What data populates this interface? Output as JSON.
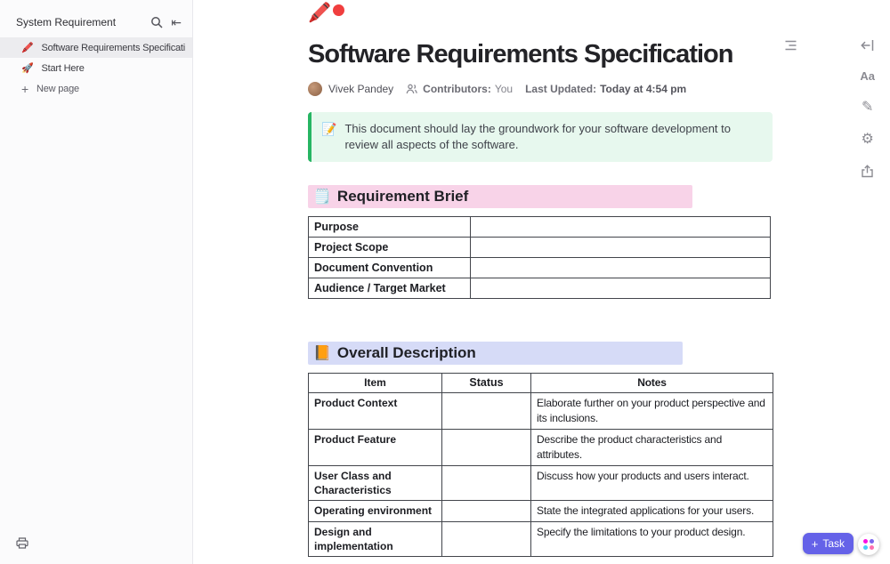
{
  "sidebar": {
    "title": "System Requirement",
    "collapse_icon": "⇤",
    "items": [
      {
        "icon": "🖍️",
        "label": "Software Requirements Specification",
        "selected": true
      },
      {
        "icon": "🚀",
        "label": "Start Here",
        "selected": false
      }
    ],
    "new_page": {
      "icon": "+",
      "label": "New page"
    }
  },
  "doc": {
    "page_icon": "🖍️",
    "title": "Software Requirements Specification",
    "meta": {
      "author": "Vivek Pandey",
      "contributors_label": "Contributors:",
      "contributors_value": "You",
      "updated_label": "Last Updated:",
      "updated_value": "Today at 4:54 pm"
    },
    "callout": {
      "icon": "📝",
      "text": "This document should lay the groundwork for your software development to review all aspects of the software."
    },
    "section_brief": {
      "icon": "🗒️",
      "title": "Requirement Brief"
    },
    "brief_rows": [
      {
        "label": "Purpose",
        "value": ""
      },
      {
        "label": "Project Scope",
        "value": ""
      },
      {
        "label": "Document Convention",
        "value": ""
      },
      {
        "label": "Audience / Target Market",
        "value": ""
      }
    ],
    "section_overall": {
      "icon": "📙",
      "title": "Overall Description"
    },
    "overall_table": {
      "headers": [
        "Item",
        "Status",
        "Notes"
      ],
      "rows": [
        {
          "item": "Product Context",
          "status": "",
          "notes": "Elaborate further on your product perspective and its inclusions."
        },
        {
          "item": "Product Feature",
          "status": "",
          "notes": "Describe the product characteristics and attributes."
        },
        {
          "item": "User Class and Characteristics",
          "status": "",
          "notes": "Discuss how your products and users interact."
        },
        {
          "item": "Operating environment",
          "status": "",
          "notes": "State the integrated applications for your users."
        },
        {
          "item": "Design and implementation",
          "status": "",
          "notes": "Specify the limitations to your product design."
        }
      ]
    }
  },
  "right_rail": {
    "font_icon": "Aa",
    "pencil_icon": "✎",
    "gear_icon": "⚙"
  },
  "footer": {
    "task_plus": "+",
    "task_label": "Task"
  },
  "colors": {
    "callout_green": "#27b563",
    "callout_bg": "#e7f8ee",
    "brief_highlight": "#f8d3e8",
    "overall_highlight": "#d6dbf7",
    "task_button": "#6562e8"
  }
}
